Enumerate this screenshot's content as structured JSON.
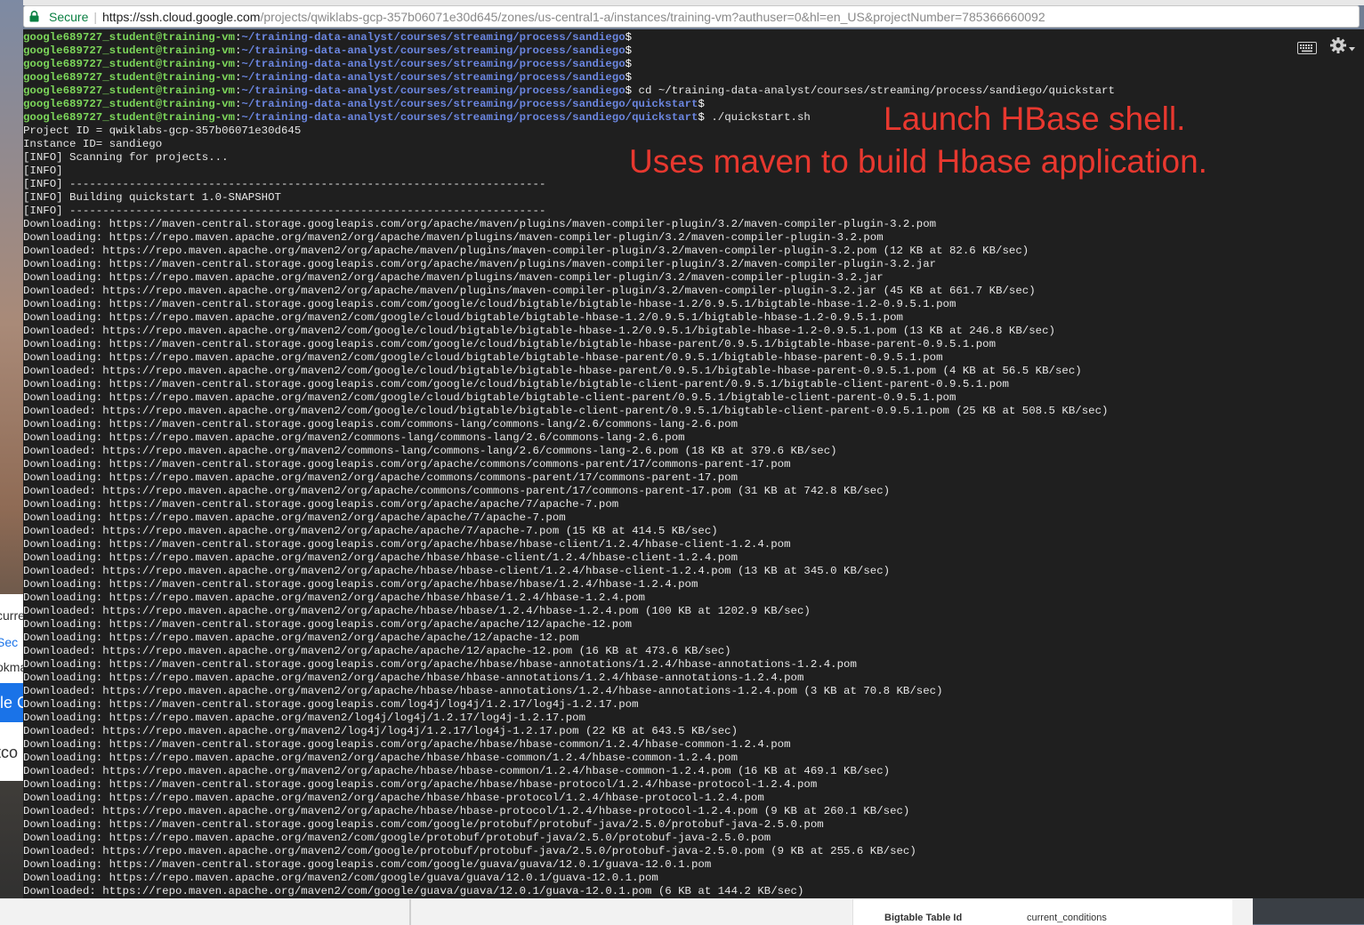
{
  "browser": {
    "secure_label": "Secure",
    "url_host": "https://ssh.cloud.google.com",
    "url_path": "/projects/qwiklabs-gcp-357b06071e30d645/zones/us-central1-a/instances/training-vm?authuser=0&hl=en_US&projectNumber=785366660092"
  },
  "background": {
    "left_fragments": [
      "curre",
      "Sec",
      "okma",
      "le C",
      "tco"
    ],
    "table_key": "Bigtable Table Id",
    "table_value": "current_conditions"
  },
  "terminal": {
    "prompts": [
      {
        "user": "google689727_student@training-vm",
        "path": "~/training-data-analyst/courses/streaming/process/sandiego",
        "cmd": ""
      },
      {
        "user": "google689727_student@training-vm",
        "path": "~/training-data-analyst/courses/streaming/process/sandiego",
        "cmd": ""
      },
      {
        "user": "google689727_student@training-vm",
        "path": "~/training-data-analyst/courses/streaming/process/sandiego",
        "cmd": ""
      },
      {
        "user": "google689727_student@training-vm",
        "path": "~/training-data-analyst/courses/streaming/process/sandiego",
        "cmd": ""
      },
      {
        "user": "google689727_student@training-vm",
        "path": "~/training-data-analyst/courses/streaming/process/sandiego",
        "cmd": " cd ~/training-data-analyst/courses/streaming/process/sandiego/quickstart"
      },
      {
        "user": "google689727_student@training-vm",
        "path": "~/training-data-analyst/courses/streaming/process/sandiego/quickstart",
        "cmd": ""
      },
      {
        "user": "google689727_student@training-vm",
        "path": "~/training-data-analyst/courses/streaming/process/sandiego/quickstart",
        "cmd": " ./quickstart.sh"
      }
    ],
    "output": [
      "Project ID = qwiklabs-gcp-357b06071e30d645",
      "Instance ID= sandiego",
      "[INFO] Scanning for projects...",
      "[INFO]",
      "[INFO] ------------------------------------------------------------------------",
      "[INFO] Building quickstart 1.0-SNAPSHOT",
      "[INFO] ------------------------------------------------------------------------",
      "Downloading: https://maven-central.storage.googleapis.com/org/apache/maven/plugins/maven-compiler-plugin/3.2/maven-compiler-plugin-3.2.pom",
      "Downloading: https://repo.maven.apache.org/maven2/org/apache/maven/plugins/maven-compiler-plugin/3.2/maven-compiler-plugin-3.2.pom",
      "Downloaded: https://repo.maven.apache.org/maven2/org/apache/maven/plugins/maven-compiler-plugin/3.2/maven-compiler-plugin-3.2.pom (12 KB at 82.6 KB/sec)",
      "Downloading: https://maven-central.storage.googleapis.com/org/apache/maven/plugins/maven-compiler-plugin/3.2/maven-compiler-plugin-3.2.jar",
      "Downloading: https://repo.maven.apache.org/maven2/org/apache/maven/plugins/maven-compiler-plugin/3.2/maven-compiler-plugin-3.2.jar",
      "Downloaded: https://repo.maven.apache.org/maven2/org/apache/maven/plugins/maven-compiler-plugin/3.2/maven-compiler-plugin-3.2.jar (45 KB at 661.7 KB/sec)",
      "Downloading: https://maven-central.storage.googleapis.com/com/google/cloud/bigtable/bigtable-hbase-1.2/0.9.5.1/bigtable-hbase-1.2-0.9.5.1.pom",
      "Downloading: https://repo.maven.apache.org/maven2/com/google/cloud/bigtable/bigtable-hbase-1.2/0.9.5.1/bigtable-hbase-1.2-0.9.5.1.pom",
      "Downloaded: https://repo.maven.apache.org/maven2/com/google/cloud/bigtable/bigtable-hbase-1.2/0.9.5.1/bigtable-hbase-1.2-0.9.5.1.pom (13 KB at 246.8 KB/sec)",
      "Downloading: https://maven-central.storage.googleapis.com/com/google/cloud/bigtable/bigtable-hbase-parent/0.9.5.1/bigtable-hbase-parent-0.9.5.1.pom",
      "Downloading: https://repo.maven.apache.org/maven2/com/google/cloud/bigtable/bigtable-hbase-parent/0.9.5.1/bigtable-hbase-parent-0.9.5.1.pom",
      "Downloaded: https://repo.maven.apache.org/maven2/com/google/cloud/bigtable/bigtable-hbase-parent/0.9.5.1/bigtable-hbase-parent-0.9.5.1.pom (4 KB at 56.5 KB/sec)",
      "Downloading: https://maven-central.storage.googleapis.com/com/google/cloud/bigtable/bigtable-client-parent/0.9.5.1/bigtable-client-parent-0.9.5.1.pom",
      "Downloading: https://repo.maven.apache.org/maven2/com/google/cloud/bigtable/bigtable-client-parent/0.9.5.1/bigtable-client-parent-0.9.5.1.pom",
      "Downloaded: https://repo.maven.apache.org/maven2/com/google/cloud/bigtable/bigtable-client-parent/0.9.5.1/bigtable-client-parent-0.9.5.1.pom (25 KB at 508.5 KB/sec)",
      "Downloading: https://maven-central.storage.googleapis.com/commons-lang/commons-lang/2.6/commons-lang-2.6.pom",
      "Downloading: https://repo.maven.apache.org/maven2/commons-lang/commons-lang/2.6/commons-lang-2.6.pom",
      "Downloaded: https://repo.maven.apache.org/maven2/commons-lang/commons-lang/2.6/commons-lang-2.6.pom (18 KB at 379.6 KB/sec)",
      "Downloading: https://maven-central.storage.googleapis.com/org/apache/commons/commons-parent/17/commons-parent-17.pom",
      "Downloading: https://repo.maven.apache.org/maven2/org/apache/commons/commons-parent/17/commons-parent-17.pom",
      "Downloaded: https://repo.maven.apache.org/maven2/org/apache/commons/commons-parent/17/commons-parent-17.pom (31 KB at 742.8 KB/sec)",
      "Downloading: https://maven-central.storage.googleapis.com/org/apache/apache/7/apache-7.pom",
      "Downloading: https://repo.maven.apache.org/maven2/org/apache/apache/7/apache-7.pom",
      "Downloaded: https://repo.maven.apache.org/maven2/org/apache/apache/7/apache-7.pom (15 KB at 414.5 KB/sec)",
      "Downloading: https://maven-central.storage.googleapis.com/org/apache/hbase/hbase-client/1.2.4/hbase-client-1.2.4.pom",
      "Downloading: https://repo.maven.apache.org/maven2/org/apache/hbase/hbase-client/1.2.4/hbase-client-1.2.4.pom",
      "Downloaded: https://repo.maven.apache.org/maven2/org/apache/hbase/hbase-client/1.2.4/hbase-client-1.2.4.pom (13 KB at 345.0 KB/sec)",
      "Downloading: https://maven-central.storage.googleapis.com/org/apache/hbase/hbase/1.2.4/hbase-1.2.4.pom",
      "Downloading: https://repo.maven.apache.org/maven2/org/apache/hbase/hbase/1.2.4/hbase-1.2.4.pom",
      "Downloaded: https://repo.maven.apache.org/maven2/org/apache/hbase/hbase/1.2.4/hbase-1.2.4.pom (100 KB at 1202.9 KB/sec)",
      "Downloading: https://maven-central.storage.googleapis.com/org/apache/apache/12/apache-12.pom",
      "Downloading: https://repo.maven.apache.org/maven2/org/apache/apache/12/apache-12.pom",
      "Downloaded: https://repo.maven.apache.org/maven2/org/apache/apache/12/apache-12.pom (16 KB at 473.6 KB/sec)",
      "Downloading: https://maven-central.storage.googleapis.com/org/apache/hbase/hbase-annotations/1.2.4/hbase-annotations-1.2.4.pom",
      "Downloading: https://repo.maven.apache.org/maven2/org/apache/hbase/hbase-annotations/1.2.4/hbase-annotations-1.2.4.pom",
      "Downloaded: https://repo.maven.apache.org/maven2/org/apache/hbase/hbase-annotations/1.2.4/hbase-annotations-1.2.4.pom (3 KB at 70.8 KB/sec)",
      "Downloading: https://maven-central.storage.googleapis.com/log4j/log4j/1.2.17/log4j-1.2.17.pom",
      "Downloading: https://repo.maven.apache.org/maven2/log4j/log4j/1.2.17/log4j-1.2.17.pom",
      "Downloaded: https://repo.maven.apache.org/maven2/log4j/log4j/1.2.17/log4j-1.2.17.pom (22 KB at 643.5 KB/sec)",
      "Downloading: https://maven-central.storage.googleapis.com/org/apache/hbase/hbase-common/1.2.4/hbase-common-1.2.4.pom",
      "Downloading: https://repo.maven.apache.org/maven2/org/apache/hbase/hbase-common/1.2.4/hbase-common-1.2.4.pom",
      "Downloaded: https://repo.maven.apache.org/maven2/org/apache/hbase/hbase-common/1.2.4/hbase-common-1.2.4.pom (16 KB at 469.1 KB/sec)",
      "Downloading: https://maven-central.storage.googleapis.com/org/apache/hbase/hbase-protocol/1.2.4/hbase-protocol-1.2.4.pom",
      "Downloading: https://repo.maven.apache.org/maven2/org/apache/hbase/hbase-protocol/1.2.4/hbase-protocol-1.2.4.pom",
      "Downloaded: https://repo.maven.apache.org/maven2/org/apache/hbase/hbase-protocol/1.2.4/hbase-protocol-1.2.4.pom (9 KB at 260.1 KB/sec)",
      "Downloading: https://maven-central.storage.googleapis.com/com/google/protobuf/protobuf-java/2.5.0/protobuf-java-2.5.0.pom",
      "Downloading: https://repo.maven.apache.org/maven2/com/google/protobuf/protobuf-java/2.5.0/protobuf-java-2.5.0.pom",
      "Downloaded: https://repo.maven.apache.org/maven2/com/google/protobuf/protobuf-java/2.5.0/protobuf-java-2.5.0.pom (9 KB at 255.6 KB/sec)",
      "Downloading: https://maven-central.storage.googleapis.com/com/google/guava/guava/12.0.1/guava-12.0.1.pom",
      "Downloading: https://repo.maven.apache.org/maven2/com/google/guava/guava/12.0.1/guava-12.0.1.pom",
      "Downloaded: https://repo.maven.apache.org/maven2/com/google/guava/guava/12.0.1/guava-12.0.1.pom (6 KB at 144.2 KB/sec)"
    ]
  },
  "annotations": {
    "line1": "Launch HBase shell.",
    "line2": "Uses maven to build Hbase application."
  },
  "colors": {
    "prompt_user": "#7cd65a",
    "prompt_path": "#6b86e0",
    "annotation": "#e8382f",
    "terminal_bg": "#1f1f1f"
  },
  "icons": [
    "lock-icon",
    "keyboard-icon",
    "gear-icon",
    "dropdown-caret-icon"
  ]
}
